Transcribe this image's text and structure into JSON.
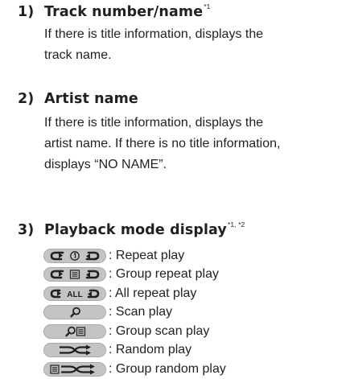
{
  "sections": [
    {
      "number": "1)",
      "title": "Track number/name",
      "footnote": "*1",
      "description": [
        "If there is title information, displays the",
        "track name."
      ]
    },
    {
      "number": "2)",
      "title": "Artist name",
      "footnote": "",
      "description": [
        "If there is title information, displays the",
        "artist name. If there is no title information,",
        "displays “NO NAME”."
      ]
    },
    {
      "number": "3)",
      "title": "Playback mode display",
      "footnote": "*1, *2",
      "description": []
    }
  ],
  "playback_modes": [
    {
      "icon": "repeat-one-icon",
      "label": ": Repeat play"
    },
    {
      "icon": "group-repeat-icon",
      "label": ": Group repeat play"
    },
    {
      "icon": "all-repeat-icon",
      "label": ": All repeat play",
      "icon_text": "ALL"
    },
    {
      "icon": "scan-icon",
      "label": ": Scan play"
    },
    {
      "icon": "group-scan-icon",
      "label": ": Group scan play"
    },
    {
      "icon": "random-icon",
      "label": ": Random play"
    },
    {
      "icon": "group-random-icon",
      "label": ": Group random play"
    }
  ],
  "colors": {
    "text": "#231f20",
    "badge_fill": "#c4c4c4",
    "badge_border": "#aaaaaa",
    "icon": "#231f20"
  }
}
